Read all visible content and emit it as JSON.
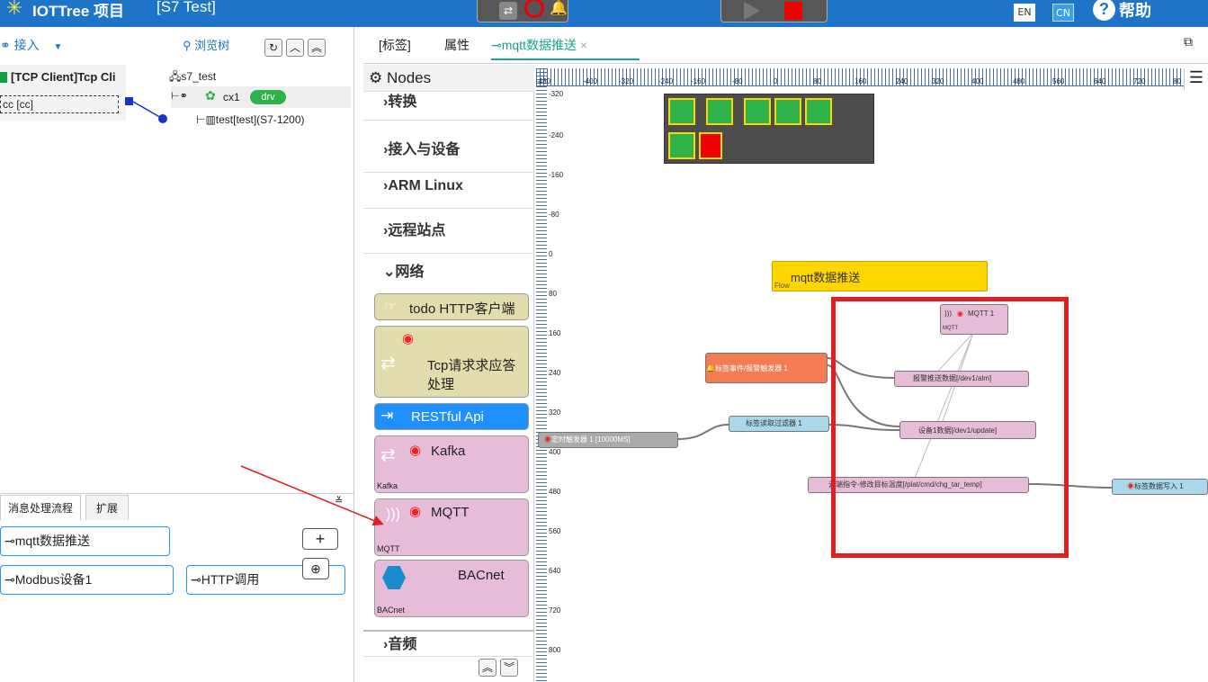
{
  "header": {
    "app_title": "IOTTree 项目",
    "project": "[S7 Test]",
    "lang_en": "EN",
    "lang_cn": "CN",
    "help": "帮助"
  },
  "left": {
    "connect_label": "接入",
    "browse_label": "浏览树",
    "connector": "[TCP Client]Tcp Cli",
    "connector_sub": "cc [cc]",
    "tree_root": "s7_test",
    "tree_ch": "cx1",
    "tree_drv": "drv",
    "tree_dev": "test[test](S7-1200)"
  },
  "flows": {
    "tab_flows": "消息处理流程",
    "tab_ext": "扩展",
    "items": [
      "mqtt数据推送",
      "Modbus设备1",
      "HTTP调用"
    ]
  },
  "tabs": [
    "[标签]",
    "属性",
    "mqtt数据推送"
  ],
  "palette": {
    "title": "Nodes",
    "cats": [
      "转换",
      "接入与设备",
      "ARM Linux",
      "远程站点",
      "网络",
      "音频"
    ],
    "nodes": [
      "todo HTTP客户端",
      "Tcp请求求应答处理",
      "RESTful Api",
      "Kafka",
      "MQTT",
      "BACnet"
    ],
    "node_subs": [
      "Kafka",
      "MQTT",
      "BACnet"
    ]
  },
  "ruler": {
    "top": [
      "-480",
      "-400",
      "-320",
      "-240",
      "-160",
      "-80",
      "0",
      "80",
      "160",
      "240",
      "320",
      "400",
      "480",
      "560",
      "640",
      "720",
      "80"
    ],
    "left": [
      "-320",
      "-240",
      "-160",
      "-80",
      "0",
      "80",
      "160",
      "240",
      "320",
      "400",
      "480",
      "560",
      "640",
      "720",
      "800"
    ]
  },
  "canvas": {
    "flow_title": "mqtt数据推送",
    "flow_sub": "Flow",
    "n_mqtt": "MQTT 1",
    "n_mqtt_sub": "MQTT",
    "n_trigger": "标签事件/报警触发器 1",
    "n_alarm": "报警推送数据[/dev1/alm]",
    "n_filter": "标签读取过滤器 1",
    "n_update": "设备1数据[/dev1/update]",
    "n_timer": "定时触发器 1 [10000MS]",
    "n_cmd": "云端指令-修改目标温度[/plat/cmd/chg_tar_temp]",
    "n_write": "标签数据写入 1"
  },
  "colors": {
    "accent": "#1e74c6",
    "highlight": "#e02020",
    "flow_yellow": "#ffd700",
    "node_pink": "#e6bcd8",
    "node_blue": "#1e90ff",
    "node_olive": "#e2ddad",
    "node_orange": "#f47c52",
    "node_cyan": "#a8d8ea"
  }
}
